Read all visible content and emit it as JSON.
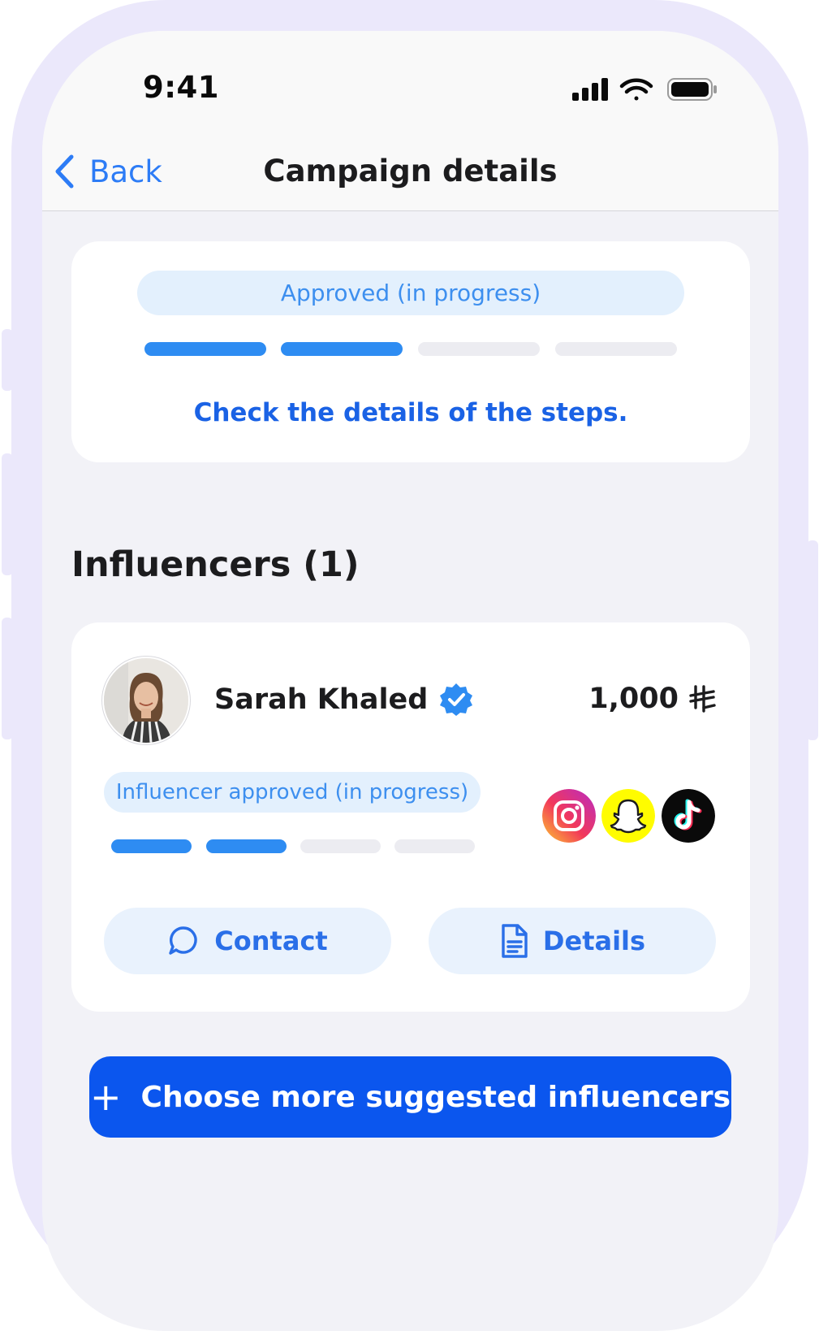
{
  "status_bar": {
    "time": "9:41"
  },
  "nav": {
    "back_label": "Back",
    "title": "Campaign details"
  },
  "campaign_status": {
    "badge": "Approved (in progress)",
    "steps_completed": 2,
    "steps_total": 4,
    "link": "Check the details of the steps."
  },
  "influencers": {
    "heading": "Influencers (1)",
    "items": [
      {
        "name": "Sarah Khaled",
        "verified": true,
        "price": "1,000",
        "currency_icon": "saudi-riyal-icon",
        "status": "Influencer approved (in progress)",
        "steps_completed": 2,
        "steps_total": 4,
        "platforms": [
          "instagram-icon",
          "snapchat-icon",
          "tiktok-icon"
        ],
        "contact_label": "Contact",
        "details_label": "Details"
      }
    ]
  },
  "cta": {
    "label": "Choose more suggested influencers",
    "icon": "plus-icon"
  },
  "colors": {
    "primary": "#0b56ee",
    "accent": "#2e8cf2",
    "badge_bg": "#e3f0fd",
    "frame": "#ebe8fb"
  }
}
